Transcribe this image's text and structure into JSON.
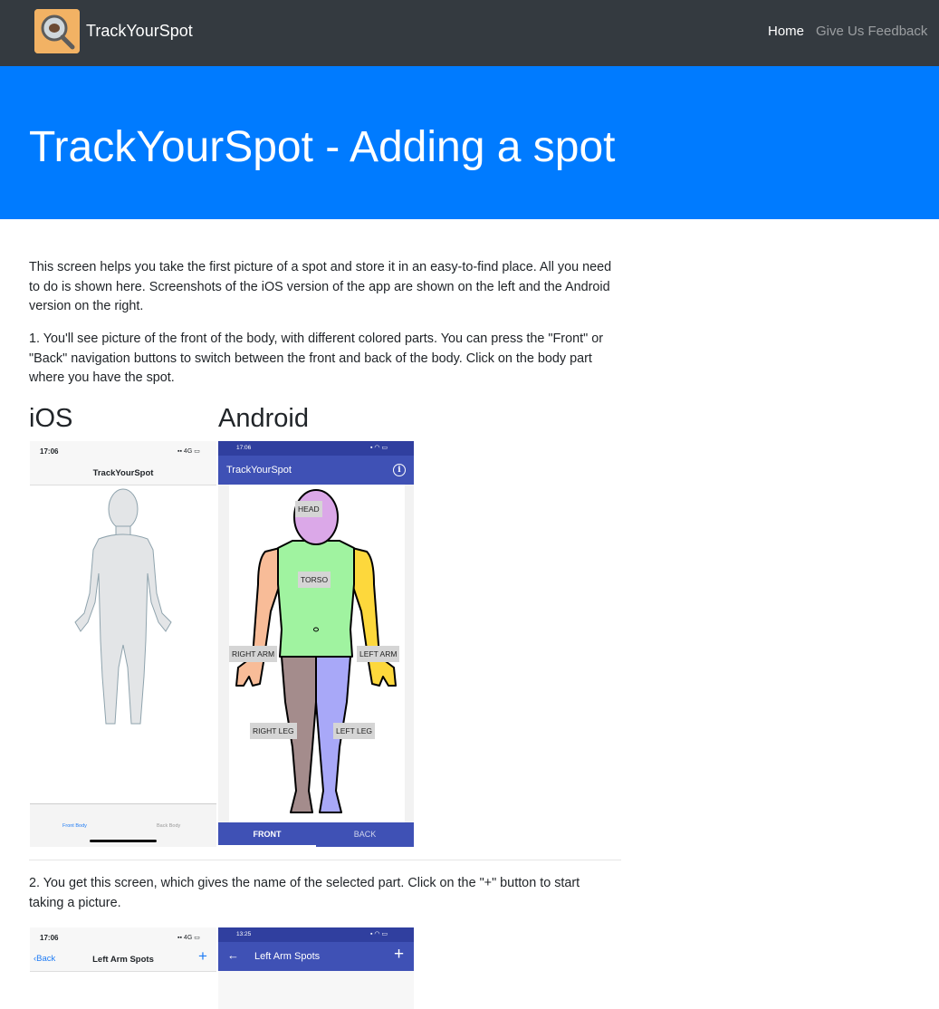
{
  "navbar": {
    "brand": "TrackYourSpot",
    "links": [
      {
        "label": "Home",
        "active": true
      },
      {
        "label": "Give Us Feedback",
        "active": false
      }
    ]
  },
  "hero": {
    "title": "TrackYourSpot - Adding a spot",
    "background": "#007bff"
  },
  "intro": "This screen helps you take the first picture of a spot and store it in an easy-to-find place. All you need to do is shown here. Screenshots of the iOS version of the app are shown on the left and the Android version on the right.",
  "step1": {
    "text": "1. You'll see picture of the front of the body, with different colored parts. You can press the \"Front\" or \"Back\" navigation buttons to switch between the front and back of the body. Click on the body part where you have the spot.",
    "ios_heading": "iOS",
    "android_heading": "Android",
    "ios_screen": {
      "time": "17:06",
      "network": "4G",
      "title": "TrackYourSpot",
      "tab_front": "Front Body",
      "tab_back": "Back Body"
    },
    "android_screen": {
      "time": "17:06",
      "title": "TrackYourSpot",
      "info_icon": "info-icon",
      "labels": {
        "head": "HEAD",
        "torso": "TORSO",
        "right_arm": "RIGHT ARM",
        "left_arm": "LEFT ARM",
        "right_leg": "RIGHT LEG",
        "left_leg": "LEFT LEG"
      },
      "nav_front": "FRONT",
      "nav_back": "BACK",
      "colors": {
        "head": "#dba8e8",
        "torso": "#a0f3a0",
        "right_arm": "#f8bc98",
        "left_arm": "#fdd83c",
        "right_leg": "#a48c8c",
        "left_leg": "#a8a8f8",
        "primary": "#3f51b5",
        "primary_dark": "#303f9f"
      }
    }
  },
  "step2": {
    "text": "2. You get this screen, which gives the name of the selected part. Click on the \"+\" button to start taking a picture.",
    "ios_screen": {
      "time": "17:06",
      "network": "4G",
      "back": "Back",
      "title": "Left Arm Spots",
      "plus": "+"
    },
    "android_screen": {
      "time": "13:25",
      "title": "Left Arm Spots",
      "plus": "+"
    }
  }
}
